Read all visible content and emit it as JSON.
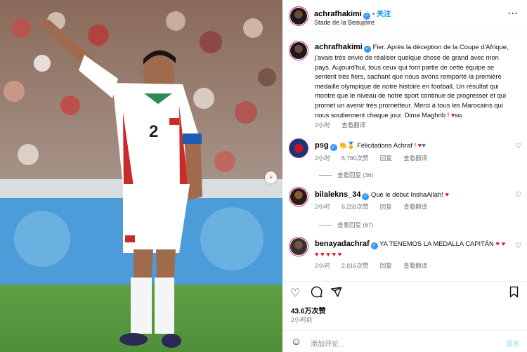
{
  "header": {
    "username": "achrafhakimi",
    "follow_label": "关注",
    "location": "Stade de la Beaujoire",
    "more_icon": "more-horizontal-icon"
  },
  "caption": {
    "username": "achrafhakimi",
    "text": "Fier. Après la déception de la Coupe d'Afrique, j'avais très envie de réaliser quelque chose de grand avec mon pays. Aujourd'hui, tous ceux qui font partie de cette équipe se sentent très fiers, sachant que nous avons remporté la première médaille olympique de notre histoire en football. Un résultat qui montre que le niveau de notre sport continue de progresser et qui promet un avenir très prometteur. Merci à tous les Marocains qui nous soutiennent chaque jour. Dima Maghrib !",
    "flag": "MA",
    "time": "2小时",
    "translate_label": "查看翻译"
  },
  "comments": [
    {
      "username": "psg",
      "text": "Félicitations Achraf !",
      "time": "2小时",
      "likes": "6,780次赞",
      "reply_label": "回复",
      "translate_label": "查看翻译",
      "replies_label": "查看回复 (36)"
    },
    {
      "username": "bilalekns_34",
      "text": "Que le début InshaAllah!",
      "time": "2小时",
      "likes": "6,259次赞",
      "reply_label": "回复",
      "translate_label": "查看翻译",
      "replies_label": "查看回复 (67)"
    },
    {
      "username": "benayadachraf",
      "text": "YA TENEMOS LA MEDALLA CAPITÁN",
      "time": "2小时",
      "likes": "2,816次赞",
      "reply_label": "回复",
      "translate_label": "查看翻译"
    }
  ],
  "post": {
    "likes": "43.6万次赞",
    "time": "2小时前"
  },
  "add_comment": {
    "placeholder": "添加评论...",
    "post_label": "发布"
  },
  "colors": {
    "link_blue": "#0095f6",
    "verified_blue": "#3897f0",
    "heart_red": "#e0182d"
  }
}
